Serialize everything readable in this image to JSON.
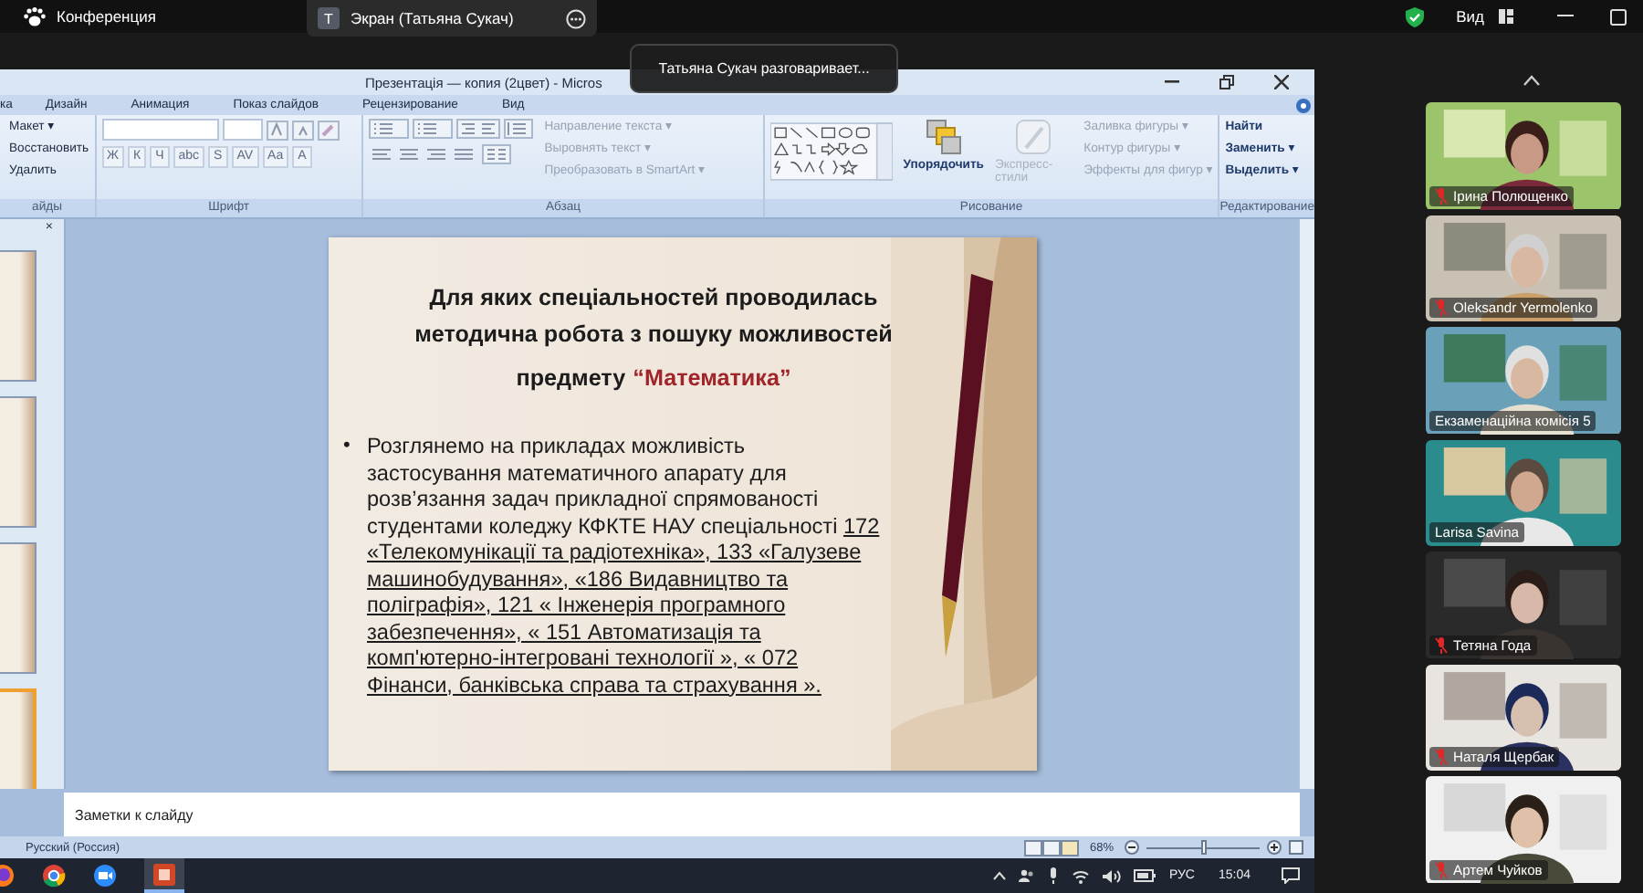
{
  "zoom_bar": {
    "title": "Конференция",
    "share": {
      "avatar": "T",
      "label": "Экран (Татьяна Сукач)"
    },
    "view": "Вид"
  },
  "tooltip": "Татьяна Сукач разговаривает...",
  "powerpoint": {
    "title": "Презентація — копия (2цвет) - Micros",
    "tabs": [
      "ка",
      "Дизайн",
      "Анимация",
      "Показ слайдов",
      "Рецензирование",
      "Вид"
    ],
    "ribbon": {
      "slides_group": {
        "label": "айды",
        "commands": [
          "Макет ▾",
          "Восстановить",
          "Удалить"
        ]
      },
      "font_group": {
        "label": "Шрифт",
        "buttons": [
          "Ж",
          "К",
          "Ч",
          "abc",
          "S",
          "AV",
          "Aa",
          "A"
        ]
      },
      "paragraph_group": {
        "label": "Абзац",
        "commands": [
          {
            "label": "Направление текста ▾",
            "disabled": true
          },
          {
            "label": "Выровнять текст ▾",
            "disabled": true
          },
          {
            "label": "Преобразовать в SmartArt ▾",
            "disabled": true
          }
        ]
      },
      "drawing_group": {
        "label": "Рисование",
        "arrange": {
          "label": "Упорядочить",
          "disabled": false
        },
        "styles": {
          "label": "Экспресс-стили",
          "disabled": true
        },
        "commands": [
          {
            "label": "Заливка фигуры ▾",
            "disabled": true
          },
          {
            "label": "Контур фигуры ▾",
            "disabled": true
          },
          {
            "label": "Эффекты для фигур ▾",
            "disabled": true
          }
        ]
      },
      "editing_group": {
        "label": "Редактирование",
        "commands": [
          "Найти",
          "Заменить ▾",
          "Выделить ▾"
        ]
      }
    },
    "pane_close": "×",
    "slides": [
      {
        "selected": false
      },
      {
        "selected": false
      },
      {
        "selected": false
      },
      {
        "selected": true
      }
    ],
    "slide": {
      "title_lines": [
        "Для яких спеціальностей  проводилась",
        "методична робота з пошуку можливостей",
        "предмету"
      ],
      "title_highlight": "“Математика”",
      "bullet": "•",
      "body_lines": [
        [
          {
            "text": "Розглянемо на прикладах можливість",
            "underlined": false
          }
        ],
        [
          {
            "text": "застосування   математичного апарату для",
            "underlined": false
          }
        ],
        [
          {
            "text": "розв’язання задач  прикладної спрямованості",
            "underlined": false
          }
        ],
        [
          {
            "text": "студентами коледжу КФКТЕ НАУ спеціальності ",
            "underlined": false
          },
          {
            "text": "172",
            "underlined": true
          }
        ],
        [
          {
            "text": "«Телекомунікації та радіотехніка», 133 «Галузеве",
            "underlined": true
          }
        ],
        [
          {
            "text": "машинобудування», «186  Видавництво та",
            "underlined": true
          }
        ],
        [
          {
            "text": "поліграфія»,  121 « Інженерія  програмного",
            "underlined": true
          }
        ],
        [
          {
            "text": "забезпечення», « 151  Автоматизація та",
            "underlined": true
          }
        ],
        [
          {
            "text": "комп'ютерно-інтегровані технології », « 072",
            "underlined": true
          }
        ],
        [
          {
            "text": "Фінанси, банківська справа та страхування ».",
            "underlined": true
          }
        ]
      ]
    },
    "notes_placeholder": "Заметки к слайду",
    "status": {
      "language": "Русский (Россия)",
      "zoom": "68%",
      "level": 0.5
    }
  },
  "taskbar": {
    "language": "РУС",
    "time": "15:04"
  },
  "participants": [
    {
      "name": "Ірина Полющенко",
      "muted": true
    },
    {
      "name": "Oleksandr Yermolenko",
      "muted": true
    },
    {
      "name": "Екзаменаційна комісія 5",
      "muted": false
    },
    {
      "name": "Larisa Savina",
      "muted": false
    },
    {
      "name": "Тетяна Года",
      "muted": true
    },
    {
      "name": "Наталя Щербак",
      "muted": true
    },
    {
      "name": "Артем Чуйков",
      "muted": true
    }
  ]
}
